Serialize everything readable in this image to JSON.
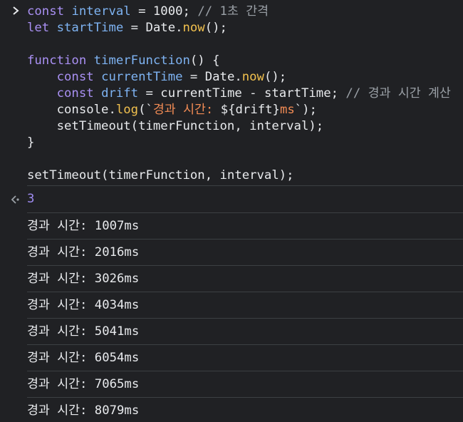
{
  "input": {
    "lines": [
      [
        {
          "t": "kw",
          "v": "const "
        },
        {
          "t": "var",
          "v": "interval"
        },
        {
          "t": "plain",
          "v": " = "
        },
        {
          "t": "num",
          "v": "1000"
        },
        {
          "t": "plain",
          "v": "; "
        },
        {
          "t": "cmt",
          "v": "// 1초 간격"
        }
      ],
      [
        {
          "t": "kw",
          "v": "let "
        },
        {
          "t": "var",
          "v": "startTime"
        },
        {
          "t": "plain",
          "v": " = Date."
        },
        {
          "t": "meth",
          "v": "now"
        },
        {
          "t": "plain",
          "v": "();"
        }
      ],
      [],
      [
        {
          "t": "kw",
          "v": "function "
        },
        {
          "t": "var",
          "v": "timerFunction"
        },
        {
          "t": "plain",
          "v": "() {"
        }
      ],
      [
        {
          "t": "plain",
          "v": "    "
        },
        {
          "t": "kw",
          "v": "const "
        },
        {
          "t": "var",
          "v": "currentTime"
        },
        {
          "t": "plain",
          "v": " = Date."
        },
        {
          "t": "meth",
          "v": "now"
        },
        {
          "t": "plain",
          "v": "();"
        }
      ],
      [
        {
          "t": "plain",
          "v": "    "
        },
        {
          "t": "kw",
          "v": "const "
        },
        {
          "t": "var",
          "v": "drift"
        },
        {
          "t": "plain",
          "v": " = currentTime - startTime; "
        },
        {
          "t": "cmt",
          "v": "// 경과 시간 계산"
        }
      ],
      [
        {
          "t": "plain",
          "v": "    console."
        },
        {
          "t": "meth",
          "v": "log"
        },
        {
          "t": "plain",
          "v": "(`"
        },
        {
          "t": "str",
          "v": "경과 시간: "
        },
        {
          "t": "plain",
          "v": "${drift}"
        },
        {
          "t": "str",
          "v": "ms"
        },
        {
          "t": "plain",
          "v": "`);"
        }
      ],
      [
        {
          "t": "plain",
          "v": "    setTimeout(timerFunction, interval);"
        }
      ],
      [
        {
          "t": "plain",
          "v": "}"
        }
      ],
      [],
      [
        {
          "t": "plain",
          "v": "setTimeout(timerFunction, interval);"
        }
      ]
    ]
  },
  "return_value": "3",
  "logs": [
    "경과 시간: 1007ms",
    "경과 시간: 2016ms",
    "경과 시간: 3026ms",
    "경과 시간: 4034ms",
    "경과 시간: 5041ms",
    "경과 시간: 6054ms",
    "경과 시간: 7065ms",
    "경과 시간: 8079ms"
  ],
  "colors": {
    "background": "#202124",
    "keyword": "#a990f3",
    "identifier": "#7eb3f2",
    "method": "#f2c14e",
    "string": "#f28b54",
    "return_value": "#9f8cf2",
    "divider": "#3c4043"
  },
  "icons": {
    "prompt": "chevron-right-icon",
    "return": "return-arrow-icon"
  }
}
